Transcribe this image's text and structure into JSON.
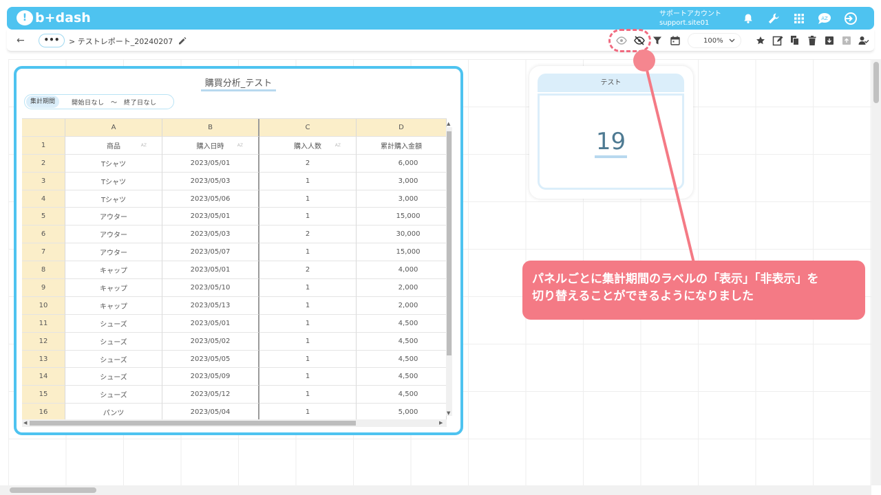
{
  "app": {
    "logo_text": "b+dash",
    "logo_mark": "!"
  },
  "account": {
    "name": "サポートアカウント",
    "site": "support.site01"
  },
  "top_icons": [
    "bell-icon",
    "wrench-icon",
    "apps-grid-icon",
    "chat-bubble-icon",
    "logout-icon"
  ],
  "toolbar": {
    "more_label": "•••",
    "breadcrumb": "> テストレポート_20240207",
    "zoom_value": "100%",
    "icons": [
      "eye-icon",
      "eye-off-icon",
      "filter-icon",
      "calendar-icon"
    ],
    "right_icons": [
      "star-icon",
      "edit-icon",
      "copy-icon",
      "trash-icon",
      "download-icon",
      "upload-icon",
      "user-check-icon"
    ]
  },
  "table_panel": {
    "title": "購買分析_テスト",
    "period_label": "集計期間",
    "period_value": "開始日なし　〜　終了日なし",
    "col_letters": [
      "A",
      "B",
      "C",
      "D"
    ],
    "headers": [
      "商品",
      "購入日時",
      "購入人数",
      "累計購入金額"
    ],
    "sort_mark": "AZ",
    "rows": [
      {
        "n": "2",
        "a": "Tシャツ",
        "b": "2023/05/01",
        "c": "2",
        "d": "6,000"
      },
      {
        "n": "3",
        "a": "Tシャツ",
        "b": "2023/05/03",
        "c": "1",
        "d": "3,000"
      },
      {
        "n": "4",
        "a": "Tシャツ",
        "b": "2023/05/06",
        "c": "1",
        "d": "3,000"
      },
      {
        "n": "5",
        "a": "アウター",
        "b": "2023/05/01",
        "c": "1",
        "d": "15,000"
      },
      {
        "n": "6",
        "a": "アウター",
        "b": "2023/05/03",
        "c": "2",
        "d": "30,000"
      },
      {
        "n": "7",
        "a": "アウター",
        "b": "2023/05/07",
        "c": "1",
        "d": "15,000"
      },
      {
        "n": "8",
        "a": "キャップ",
        "b": "2023/05/01",
        "c": "2",
        "d": "4,000"
      },
      {
        "n": "9",
        "a": "キャップ",
        "b": "2023/05/10",
        "c": "1",
        "d": "2,000"
      },
      {
        "n": "10",
        "a": "キャップ",
        "b": "2023/05/13",
        "c": "1",
        "d": "2,000"
      },
      {
        "n": "11",
        "a": "シューズ",
        "b": "2023/05/01",
        "c": "1",
        "d": "4,500"
      },
      {
        "n": "12",
        "a": "シューズ",
        "b": "2023/05/02",
        "c": "1",
        "d": "4,500"
      },
      {
        "n": "13",
        "a": "シューズ",
        "b": "2023/05/05",
        "c": "1",
        "d": "4,500"
      },
      {
        "n": "14",
        "a": "シューズ",
        "b": "2023/05/09",
        "c": "1",
        "d": "4,500"
      },
      {
        "n": "15",
        "a": "シューズ",
        "b": "2023/05/12",
        "c": "1",
        "d": "4,500"
      },
      {
        "n": "16",
        "a": "パンツ",
        "b": "2023/05/04",
        "c": "1",
        "d": "5,000"
      }
    ]
  },
  "number_panel": {
    "title": "テスト",
    "value": "19"
  },
  "callout": {
    "line1": "パネルごとに集計期間のラベルの「表示」「非表示」を",
    "line2": "切り替えることができるようになりました"
  },
  "colors": {
    "accent": "#4ec3f0",
    "callout": "#f47a85",
    "header_row": "#fbeec9"
  }
}
